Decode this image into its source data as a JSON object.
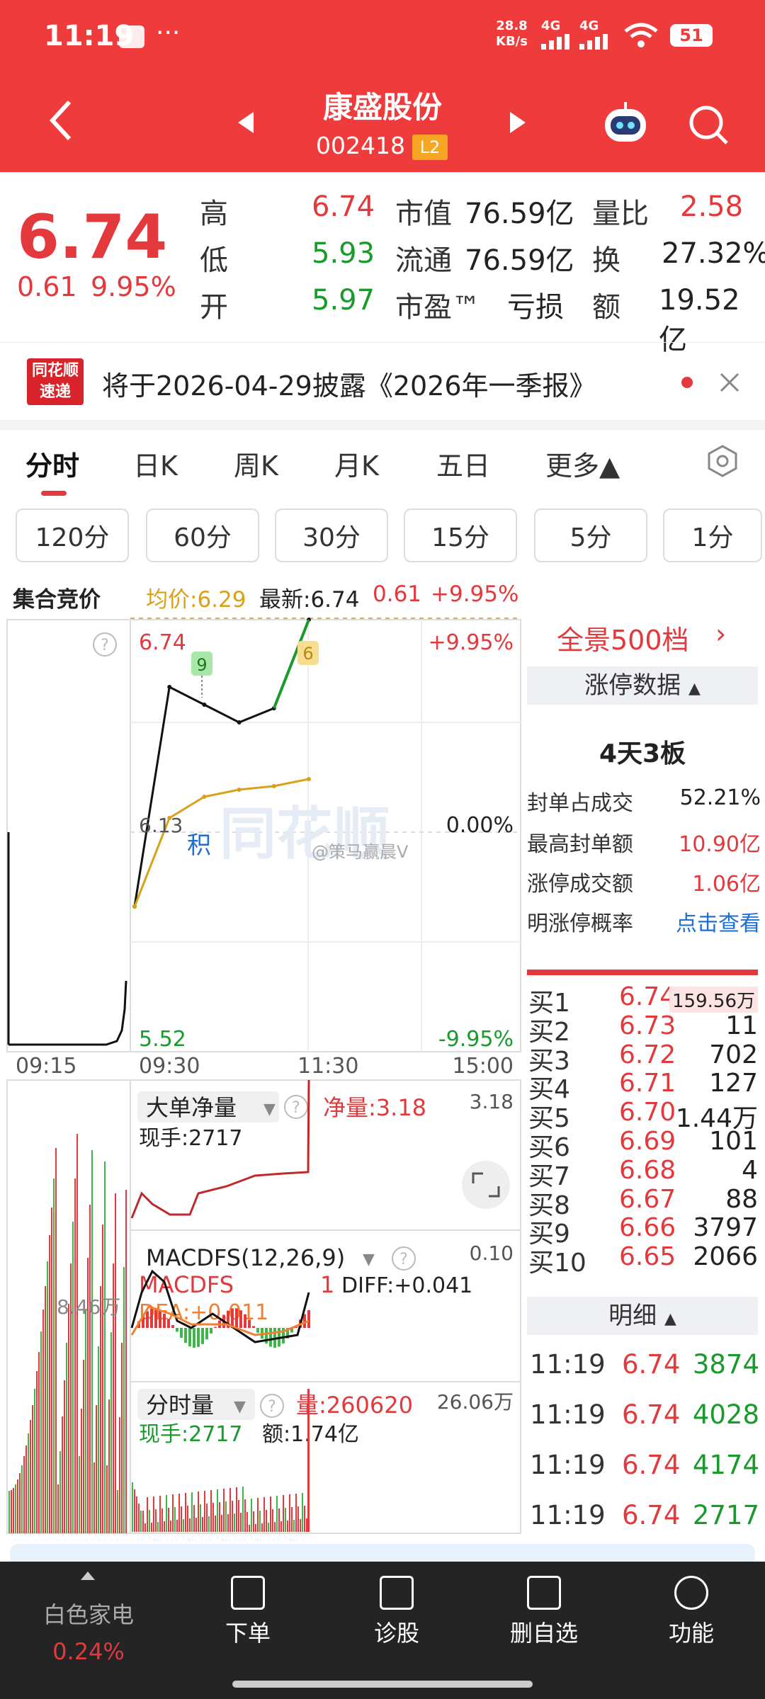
{
  "status": {
    "time": "11:19",
    "dots": "···",
    "speed_top": "28.8",
    "speed_bottom": "KB/s",
    "net1": "4G",
    "net2": "4G",
    "battery": "51"
  },
  "header": {
    "stock_name": "康盛股份",
    "stock_code": "002418",
    "level": "L2"
  },
  "quote": {
    "price": "6.74",
    "change": "0.61",
    "change_pct": "9.95%",
    "rows": [
      {
        "l1": "高",
        "v1": "6.74",
        "l2": "市值",
        "v2": "76.59亿",
        "l3": "量比",
        "v3": "2.58"
      },
      {
        "l1": "低",
        "v1": "5.93",
        "l2": "流通",
        "v2": "76.59亿",
        "l3": "换",
        "v3": "27.32%"
      },
      {
        "l1": "开",
        "v1": "5.97",
        "l2": "市盈™",
        "v2": "亏损",
        "l3": "额",
        "v3": "19.52亿"
      }
    ]
  },
  "notice": {
    "logo_top": "同花顺",
    "logo_bottom": "速递",
    "text": "将于2026-04-29披露《2026年一季报》"
  },
  "tabs": [
    "分时",
    "日K",
    "周K",
    "月K",
    "五日",
    "更多▲"
  ],
  "periods": [
    "120分",
    "60分",
    "30分",
    "15分",
    "5分",
    "1分"
  ],
  "infoline": {
    "label": "集合竞价",
    "avg": "均价:6.29",
    "latest": "最新:6.74",
    "chg": "0.61",
    "pct": "+9.95%"
  },
  "chart": {
    "top_price": "6.74",
    "top_pct": "+9.95%",
    "mid_price": "6.13",
    "mid_pct": "0.00%",
    "low_price": "5.52",
    "low_pct": "-9.95%",
    "badge_9": "9",
    "badge_6": "6",
    "ji": "积",
    "watermark": "同花顺",
    "credit": "@策马赢晨V",
    "times": [
      "09:15",
      "09:30",
      "11:30",
      "15:00"
    ],
    "auction_vol": "8.46万",
    "ind1": {
      "name": "大单净量",
      "net": "净量:3.18",
      "right": "3.18",
      "hand": "现手:2717"
    },
    "ind2": {
      "name": "MACDFS(12,26,9)",
      "line2": "MACDFS",
      "one": "1",
      "diff": "DIFF:+0.041",
      "dea": "DEA:+0.011",
      "right": "0.10"
    },
    "ind3": {
      "name": "分时量",
      "amount": "量:260620",
      "right": "26.06万",
      "hand": "现手:2717",
      "money": "额:1.74亿"
    }
  },
  "chart_data": {
    "type": "line",
    "title": "",
    "x": [
      "09:30",
      "10:00",
      "10:30",
      "11:00",
      "11:15",
      "11:19"
    ],
    "series": [
      {
        "name": "",
        "values": [
          5.93,
          6.55,
          6.5,
          6.45,
          6.49,
          6.74
        ]
      },
      {
        "name": "均价",
        "values": [
          5.93,
          6.18,
          6.24,
          6.26,
          6.27,
          6.29
        ]
      }
    ],
    "ylim": [
      5.52,
      6.74
    ]
  },
  "book": {
    "panorama": "全景500档",
    "limit_title": "涨停数据",
    "boards": "4天3板",
    "stats": [
      {
        "k": "封单占成交",
        "v": "52.21%"
      },
      {
        "k": "最高封单额",
        "v": "10.90亿"
      },
      {
        "k": "涨停成交额",
        "v": "1.06亿"
      },
      {
        "k": "明涨停概率",
        "v": "点击查看"
      }
    ],
    "bids": [
      {
        "l": "买1",
        "p": "6.74",
        "v": "159.56万"
      },
      {
        "l": "买2",
        "p": "6.73",
        "v": "11"
      },
      {
        "l": "买3",
        "p": "6.72",
        "v": "702"
      },
      {
        "l": "买4",
        "p": "6.71",
        "v": "127"
      },
      {
        "l": "买5",
        "p": "6.70",
        "v": "1.44万"
      },
      {
        "l": "买6",
        "p": "6.69",
        "v": "101"
      },
      {
        "l": "买7",
        "p": "6.68",
        "v": "4"
      },
      {
        "l": "买8",
        "p": "6.67",
        "v": "88"
      },
      {
        "l": "买9",
        "p": "6.66",
        "v": "3797"
      },
      {
        "l": "买10",
        "p": "6.65",
        "v": "2066"
      }
    ],
    "detail_title": "明细",
    "details": [
      {
        "t": "11:19",
        "p": "6.74",
        "v": "3874"
      },
      {
        "t": "11:19",
        "p": "6.74",
        "v": "4028"
      },
      {
        "t": "11:19",
        "p": "6.74",
        "v": "4174"
      },
      {
        "t": "11:19",
        "p": "6.74",
        "v": "2717"
      }
    ]
  },
  "nav": {
    "sector": "白色家电",
    "sector_pct": "0.24%",
    "items": [
      "下单",
      "诊股",
      "删自选",
      "功能"
    ]
  }
}
